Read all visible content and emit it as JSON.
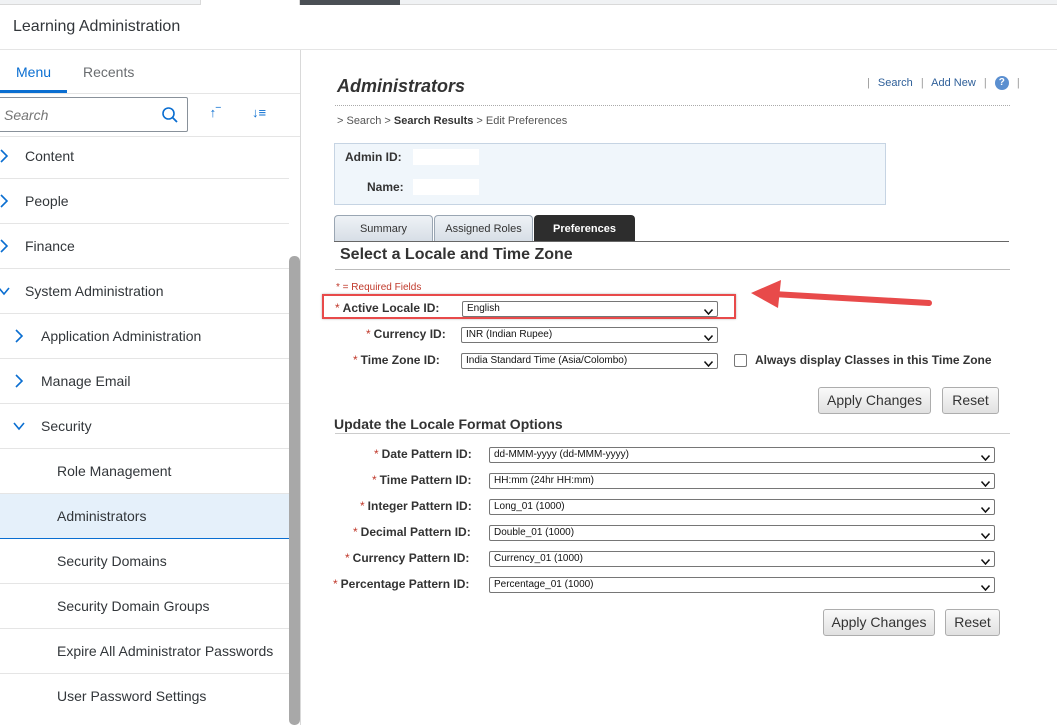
{
  "app": {
    "title": "Learning Administration"
  },
  "sidebar": {
    "tabs": [
      {
        "label": "Menu"
      },
      {
        "label": "Recents"
      }
    ],
    "search": {
      "placeholder": "Search"
    },
    "sort_up_label": "↑‾",
    "sort_down_label": "↓≡",
    "items": [
      {
        "label": "Content"
      },
      {
        "label": "People"
      },
      {
        "label": "Finance"
      },
      {
        "label": "System Administration"
      },
      {
        "label": "Application Administration"
      },
      {
        "label": "Manage Email"
      },
      {
        "label": "Security"
      },
      {
        "label": "Role Management"
      },
      {
        "label": "Administrators"
      },
      {
        "label": "Security Domains"
      },
      {
        "label": "Security Domain Groups"
      },
      {
        "label": "Expire All Administrator Passwords"
      },
      {
        "label": "User Password Settings"
      }
    ]
  },
  "page": {
    "title": "Administrators",
    "links": {
      "search": "Search",
      "add_new": "Add New",
      "help": "?"
    },
    "breadcrumb": {
      "prefix": "> Search > ",
      "current": "Search Results",
      "suffix": " > Edit Preferences"
    },
    "info": {
      "admin_id_label": "Admin ID:",
      "name_label": "Name:"
    },
    "tabs": [
      {
        "label": "Summary"
      },
      {
        "label": "Assigned Roles"
      },
      {
        "label": "Preferences"
      }
    ],
    "section1_title": "Select a Locale and Time Zone",
    "required_note": "* = Required Fields",
    "locale": {
      "label": "Active Locale ID:",
      "value": "English"
    },
    "currency": {
      "label": "Currency ID:",
      "value": "INR (Indian Rupee)"
    },
    "timezone": {
      "label": "Time Zone ID:",
      "value": "India Standard Time (Asia/Colombo)"
    },
    "always_display_label": "Always display Classes in this Time Zone",
    "apply_label": "Apply Changes",
    "reset_label": "Reset",
    "section2_title": "Update the Locale Format Options",
    "formats": [
      {
        "label": "Date Pattern ID:",
        "value": "dd-MMM-yyyy (dd-MMM-yyyy)"
      },
      {
        "label": "Time Pattern ID:",
        "value": "HH:mm (24hr HH:mm)"
      },
      {
        "label": "Integer Pattern ID:",
        "value": "Long_01 (1000)"
      },
      {
        "label": "Decimal Pattern ID:",
        "value": "Double_01 (1000)"
      },
      {
        "label": "Currency Pattern ID:",
        "value": "Currency_01 (1000)"
      },
      {
        "label": "Percentage Pattern ID:",
        "value": "Percentage_01 (1000)"
      }
    ]
  },
  "colors": {
    "accent": "#0a6ed1",
    "annotation": "#e84a4a",
    "required": "#c0392b"
  }
}
